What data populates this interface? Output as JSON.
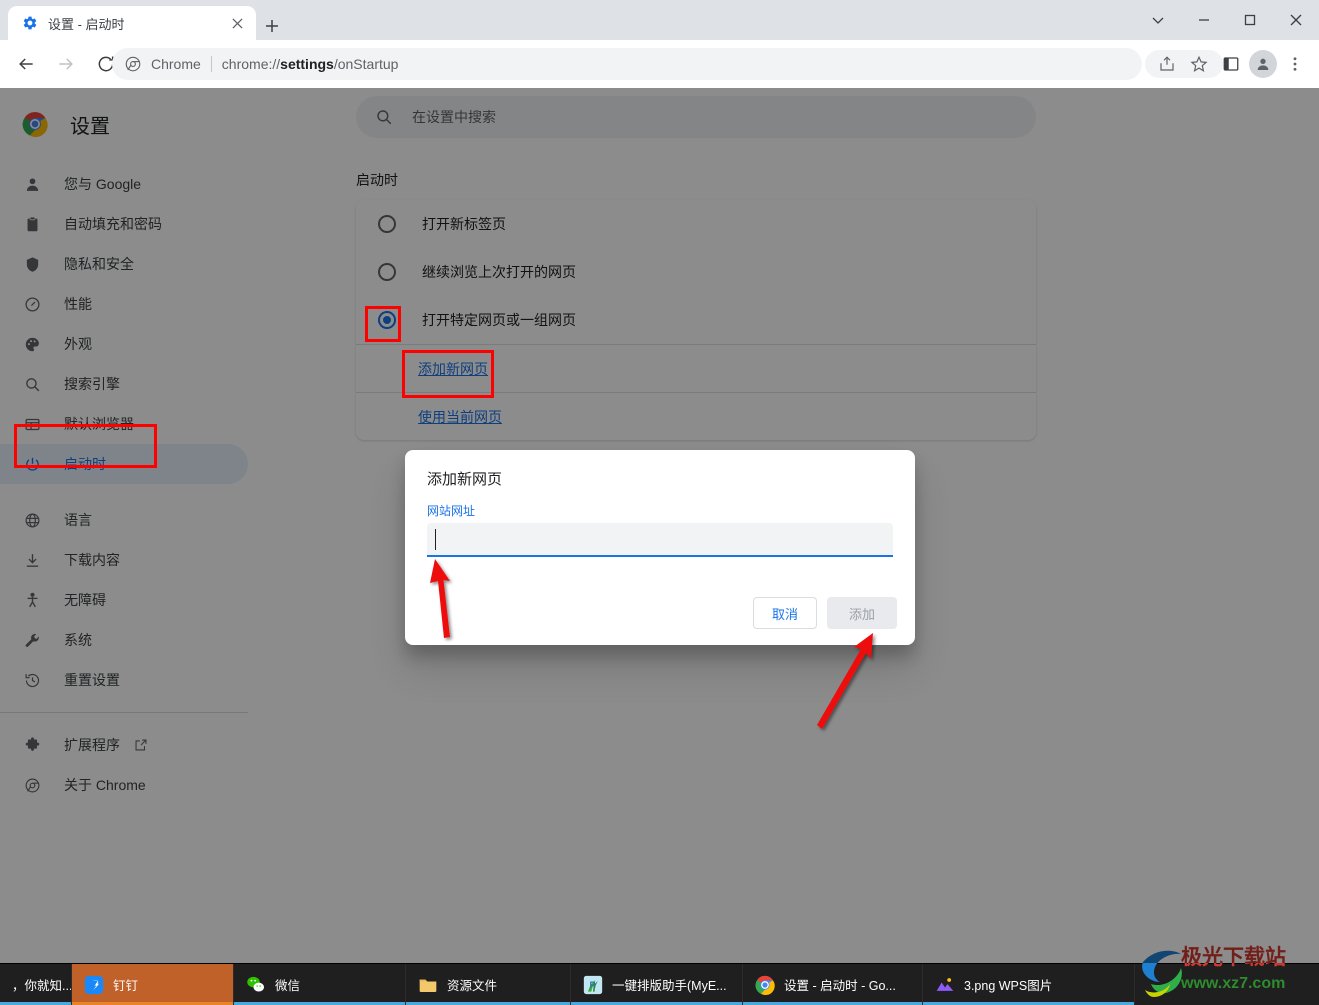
{
  "window": {
    "tab": {
      "title": "设置 - 启动时",
      "favicon_icon": "gear-icon",
      "close_icon": "close-icon"
    },
    "new_tab_icon": "plus-icon",
    "controls": {
      "dropdown_icon": "chevron-down-icon",
      "minimize_icon": "minimize-icon",
      "maximize_icon": "maximize-icon",
      "close_icon": "close-icon"
    }
  },
  "toolbar": {
    "back_icon": "arrow-back-icon",
    "forward_icon": "arrow-forward-icon",
    "reload_icon": "reload-icon",
    "omnibox": {
      "site_icon": "chrome-icon",
      "site_label": "Chrome",
      "url_prefix": "chrome://",
      "url_bold": "settings",
      "url_suffix": "/onStartup"
    },
    "share_icon": "share-icon",
    "bookmark_icon": "star-icon",
    "sidepanel_icon": "side-panel-icon",
    "profile_icon": "person-icon",
    "menu_icon": "three-dot-menu-icon"
  },
  "sidebar": {
    "logo_icon": "chrome-logo-icon",
    "title": "设置",
    "items": [
      {
        "label": "您与 Google",
        "icon": "person-icon",
        "selected": false
      },
      {
        "label": "自动填充和密码",
        "icon": "clipboard-icon",
        "selected": false
      },
      {
        "label": "隐私和安全",
        "icon": "shield-icon",
        "selected": false
      },
      {
        "label": "性能",
        "icon": "speedometer-icon",
        "selected": false
      },
      {
        "label": "外观",
        "icon": "palette-icon",
        "selected": false
      },
      {
        "label": "搜索引擎",
        "icon": "search-icon",
        "selected": false
      },
      {
        "label": "默认浏览器",
        "icon": "browser-window-icon",
        "selected": false
      },
      {
        "label": "启动时",
        "icon": "power-icon",
        "selected": true
      },
      {
        "label": "语言",
        "icon": "globe-icon",
        "selected": false
      },
      {
        "label": "下载内容",
        "icon": "download-icon",
        "selected": false
      },
      {
        "label": "无障碍",
        "icon": "accessibility-icon",
        "selected": false
      },
      {
        "label": "系统",
        "icon": "wrench-icon",
        "selected": false
      },
      {
        "label": "重置设置",
        "icon": "history-restore-icon",
        "selected": false
      }
    ],
    "footer_items": [
      {
        "label": "扩展程序",
        "icon": "puzzle-icon",
        "external_icon": "external-link-icon"
      },
      {
        "label": "关于 Chrome",
        "icon": "chrome-icon",
        "external_icon": ""
      }
    ]
  },
  "main": {
    "search": {
      "icon": "search-icon",
      "placeholder": "在设置中搜索",
      "value": ""
    },
    "section_title": "启动时",
    "options": [
      {
        "label": "打开新标签页",
        "checked": false
      },
      {
        "label": "继续浏览上次打开的网页",
        "checked": false
      },
      {
        "label": "打开特定网页或一组网页",
        "checked": true
      }
    ],
    "links": [
      {
        "label": "添加新网页"
      },
      {
        "label": "使用当前网页"
      }
    ]
  },
  "dialog": {
    "title": "添加新网页",
    "field_label": "网站网址",
    "input_value": "",
    "input_placeholder": "",
    "cancel_label": "取消",
    "confirm_label": "添加"
  },
  "annotations": {
    "highlight_color": "#ff0000",
    "arrow_color": "#ff0000",
    "boxes": [
      "sidebar-startup-item",
      "radio-specific-pages",
      "add-new-page-link"
    ],
    "arrows": [
      "arrow-to-url-input",
      "arrow-to-add-button"
    ]
  },
  "taskbar": {
    "items": [
      {
        "label": "，你就知...",
        "icon": "app-icon",
        "active": false,
        "underline": true
      },
      {
        "label": "钉钉",
        "icon": "dingtalk-icon",
        "active": true,
        "underline": true
      },
      {
        "label": "微信",
        "icon": "wechat-icon",
        "active": false,
        "underline": true
      },
      {
        "label": "资源文件",
        "icon": "folder-icon",
        "active": false,
        "underline": true
      },
      {
        "label": "一键排版助手(MyE...",
        "icon": "app-r-icon",
        "active": false,
        "underline": true
      },
      {
        "label": "设置 - 启动时 - Go...",
        "icon": "chrome-icon",
        "active": false,
        "underline": true
      },
      {
        "label": "3.png  WPS图片",
        "icon": "wps-image-icon",
        "active": false,
        "underline": true
      }
    ]
  },
  "watermark": {
    "icon": "swirl-logo-icon",
    "line1": "极光下载站",
    "line2": "www.xz7.com"
  }
}
